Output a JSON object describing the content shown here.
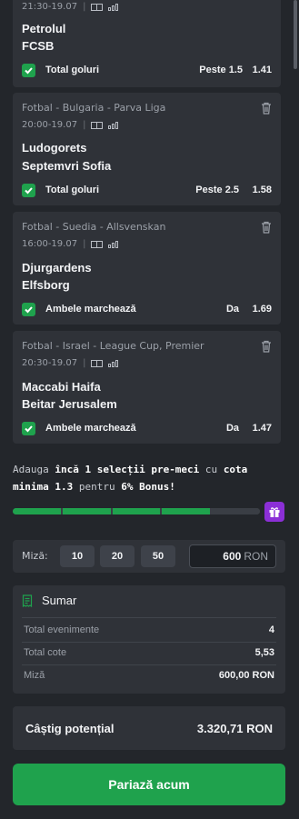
{
  "colors": {
    "accent_green": "#1fa24d",
    "gift_purple": "#8b2fd6",
    "card_bg": "#2f3238"
  },
  "selections": [
    {
      "league": "",
      "time": "21:30-19.07",
      "home": "Petrolul",
      "away": "FCSB",
      "market": "Total goluri",
      "pick": "Peste 1.5",
      "odd": "1.41"
    },
    {
      "league": "Fotbal - Bulgaria - Parva Liga",
      "time": "20:00-19.07",
      "home": "Ludogorets",
      "away": "Septemvri Sofia",
      "market": "Total goluri",
      "pick": "Peste 2.5",
      "odd": "1.58"
    },
    {
      "league": "Fotbal - Suedia - Allsvenskan",
      "time": "16:00-19.07",
      "home": "Djurgardens",
      "away": "Elfsborg",
      "market": "Ambele marchează",
      "pick": "Da",
      "odd": "1.69"
    },
    {
      "league": "Fotbal - Israel - League Cup, Premier",
      "time": "20:30-19.07",
      "home": "Maccabi Haifa",
      "away": "Beitar Jerusalem",
      "market": "Ambele marchează",
      "pick": "Da",
      "odd": "1.47"
    }
  ],
  "bonus": {
    "p1": "Adauga ",
    "b1": "încă 1 selecții pre-meci",
    "p2": " cu ",
    "b2": "cota minima 1.3",
    "p3": " pentru ",
    "b3": "6% Bonus",
    "p4": "!",
    "progress": 0.8
  },
  "stake": {
    "label": "Miză:",
    "quick": [
      "10",
      "20",
      "50"
    ],
    "value": "600",
    "currency": "RON"
  },
  "summary": {
    "title": "Sumar",
    "rows": [
      {
        "label": "Total evenimente",
        "value": "4"
      },
      {
        "label": "Total cote",
        "value": "5,53"
      },
      {
        "label": "Miză",
        "value": "600,00 RON"
      }
    ]
  },
  "payout": {
    "label": "Câștig potențial",
    "value": "3.320,71 RON"
  },
  "cta": {
    "label": "Pariază acum"
  }
}
